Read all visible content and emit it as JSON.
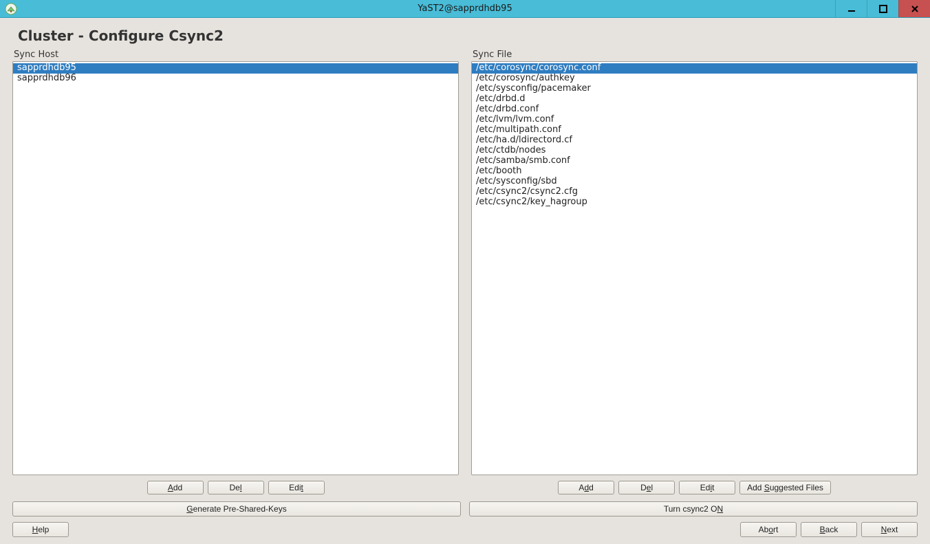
{
  "window": {
    "title": "YaST2@sapprdhdb95"
  },
  "page": {
    "title": "Cluster - Configure Csync2"
  },
  "syncHost": {
    "label": "Sync Host",
    "items": [
      "sapprdhdb95",
      "sapprdhdb96"
    ],
    "selectedIndex": 0,
    "buttons": {
      "add": "Add",
      "del": "Del",
      "edit": "Edit"
    }
  },
  "syncFile": {
    "label": "Sync File",
    "items": [
      "/etc/corosync/corosync.conf",
      "/etc/corosync/authkey",
      "/etc/sysconfig/pacemaker",
      "/etc/drbd.d",
      "/etc/drbd.conf",
      "/etc/lvm/lvm.conf",
      "/etc/multipath.conf",
      "/etc/ha.d/ldirectord.cf",
      "/etc/ctdb/nodes",
      "/etc/samba/smb.conf",
      "/etc/booth",
      "/etc/sysconfig/sbd",
      "/etc/csync2/csync2.cfg",
      "/etc/csync2/key_hagroup"
    ],
    "selectedIndex": 0,
    "buttons": {
      "add": "Add",
      "del": "Del",
      "edit": "Edit",
      "suggested": "Add Suggested Files"
    }
  },
  "wideButtons": {
    "generate": "Generate Pre-Shared-Keys",
    "turnOn": "Turn csync2 ON"
  },
  "footer": {
    "help": "Help",
    "abort": "Abort",
    "back": "Back",
    "next": "Next"
  }
}
